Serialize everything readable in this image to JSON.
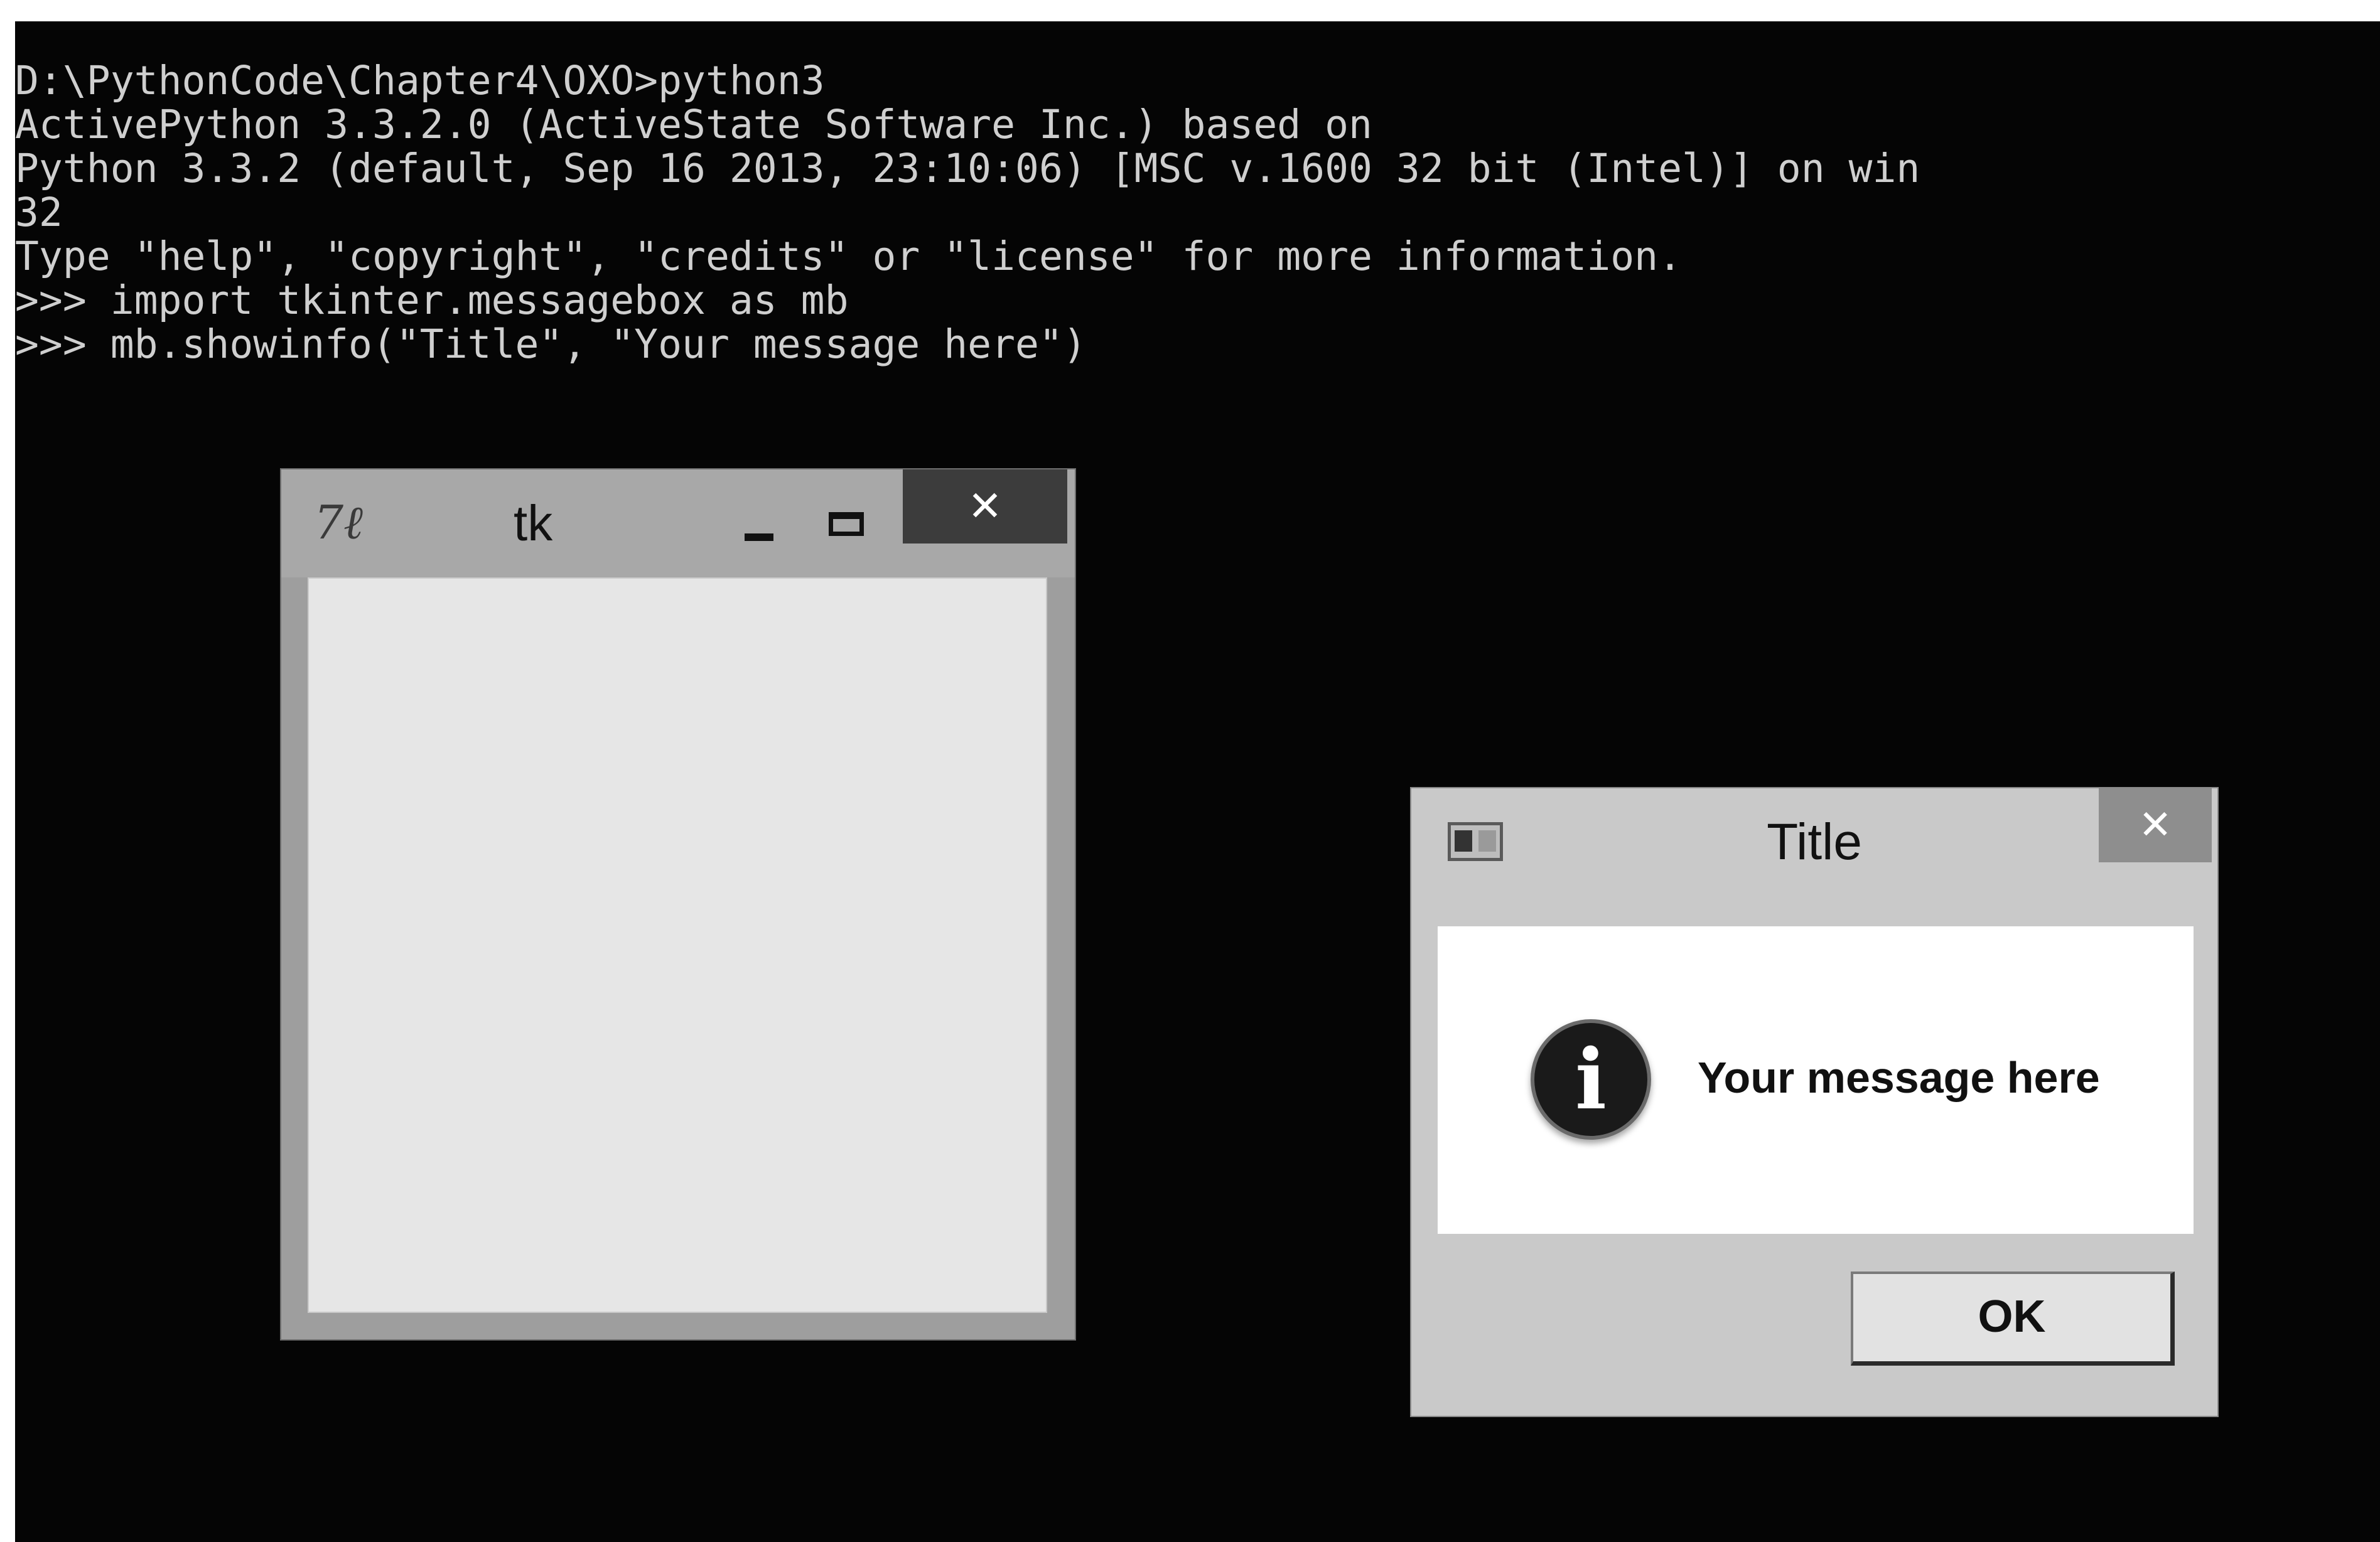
{
  "console": {
    "lines": [
      "D:\\PythonCode\\Chapter4\\OXO>python3",
      "ActivePython 3.3.2.0 (ActiveState Software Inc.) based on",
      "Python 3.3.2 (default, Sep 16 2013, 23:10:06) [MSC v.1600 32 bit (Intel)] on win",
      "32",
      "Type \"help\", \"copyright\", \"credits\" or \"license\" for more information.",
      ">>> import tkinter.messagebox as mb",
      ">>> mb.showinfo(\"Title\", \"Your message here\")"
    ]
  },
  "tk_window": {
    "logo_text": "7ℓ",
    "title": "tk",
    "minimize_icon": "minimize-icon",
    "maximize_icon": "maximize-icon",
    "close_label": "✕"
  },
  "message_box": {
    "title": "Title",
    "close_label": "✕",
    "app_icon": "window-icon",
    "info_icon": "info-icon",
    "info_glyph": "i",
    "message": "Your message here",
    "ok_label": "OK"
  },
  "colors": {
    "console_background": "#050505",
    "console_text": "#cfcfcf",
    "tk_close_button": "#3c3c3c",
    "dialog_close_button": "#8e8e8e"
  }
}
